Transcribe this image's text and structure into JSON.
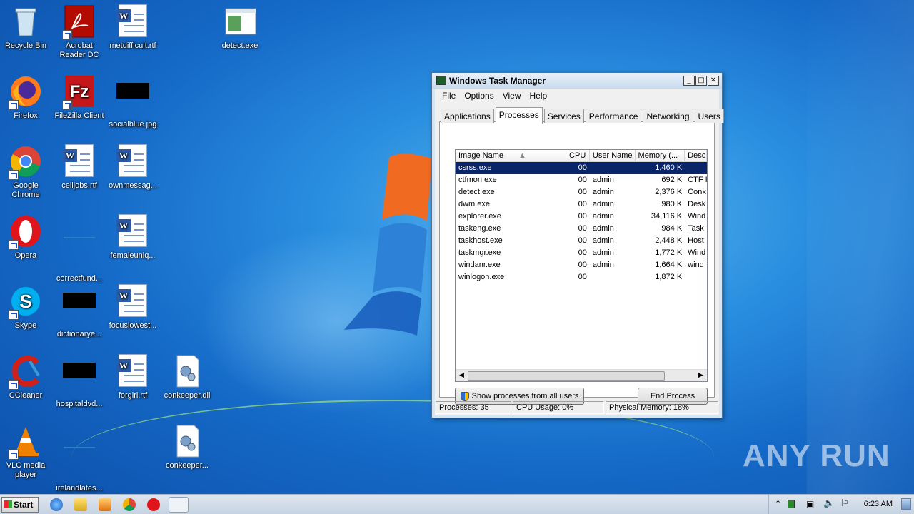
{
  "desktop": {
    "icons": [
      {
        "label": "Recycle Bin"
      },
      {
        "label": "Acrobat Reader DC"
      },
      {
        "label": "metdifficult.rtf"
      },
      {
        "label": "detect.exe"
      },
      {
        "label": "Firefox"
      },
      {
        "label": "FileZilla Client"
      },
      {
        "label": "socialblue.jpg"
      },
      {
        "label": "Google Chrome"
      },
      {
        "label": "celljobs.rtf"
      },
      {
        "label": "ownmessag..."
      },
      {
        "label": "Opera"
      },
      {
        "label": "correctfund..."
      },
      {
        "label": "femaleuniq..."
      },
      {
        "label": "Skype"
      },
      {
        "label": "dictionarye..."
      },
      {
        "label": "focuslowest..."
      },
      {
        "label": "CCleaner"
      },
      {
        "label": "hospitaldvd..."
      },
      {
        "label": "forgirl.rtf"
      },
      {
        "label": "conkeeper.dll"
      },
      {
        "label": "VLC media player"
      },
      {
        "label": "irelandlates..."
      },
      {
        "label": "conkeeper..."
      }
    ]
  },
  "taskmanager": {
    "title": "Windows Task Manager",
    "menu": [
      "File",
      "Options",
      "View",
      "Help"
    ],
    "tabs": [
      "Applications",
      "Processes",
      "Services",
      "Performance",
      "Networking",
      "Users"
    ],
    "active_tab": "Processes",
    "columns": [
      "Image Name",
      "CPU",
      "User Name",
      "Memory (...",
      "Desc"
    ],
    "rows": [
      {
        "name": "csrss.exe",
        "cpu": "00",
        "user": "",
        "mem": "1,460 K",
        "desc": ""
      },
      {
        "name": "ctfmon.exe",
        "cpu": "00",
        "user": "admin",
        "mem": "692 K",
        "desc": "CTF I"
      },
      {
        "name": "detect.exe",
        "cpu": "00",
        "user": "admin",
        "mem": "2,376 K",
        "desc": "Conk"
      },
      {
        "name": "dwm.exe",
        "cpu": "00",
        "user": "admin",
        "mem": "980 K",
        "desc": "Desk"
      },
      {
        "name": "explorer.exe",
        "cpu": "00",
        "user": "admin",
        "mem": "34,116 K",
        "desc": "Wind"
      },
      {
        "name": "taskeng.exe",
        "cpu": "00",
        "user": "admin",
        "mem": "984 K",
        "desc": "Task"
      },
      {
        "name": "taskhost.exe",
        "cpu": "00",
        "user": "admin",
        "mem": "2,448 K",
        "desc": "Host"
      },
      {
        "name": "taskmgr.exe",
        "cpu": "00",
        "user": "admin",
        "mem": "1,772 K",
        "desc": "Wind"
      },
      {
        "name": "windanr.exe",
        "cpu": "00",
        "user": "admin",
        "mem": "1,664 K",
        "desc": "wind"
      },
      {
        "name": "winlogon.exe",
        "cpu": "00",
        "user": "",
        "mem": "1,872 K",
        "desc": ""
      }
    ],
    "show_all_label": "Show processes from all users",
    "end_process_label": "End Process",
    "status": {
      "processes": "Processes: 35",
      "cpu": "CPU Usage: 0%",
      "memory": "Physical Memory: 18%"
    }
  },
  "taskbar": {
    "start_label": "Start",
    "clock": "6:23 AM"
  },
  "watermark": "ANY RUN"
}
